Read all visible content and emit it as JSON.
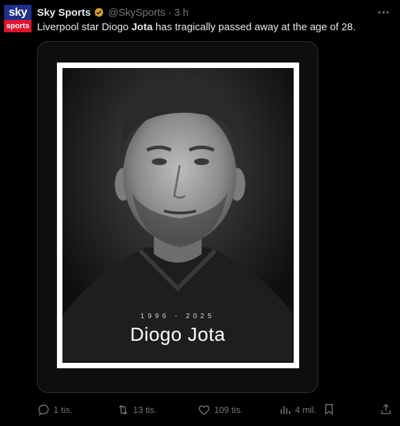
{
  "author": {
    "name": "Sky Sports",
    "handle": "@SkySports",
    "separator": "·",
    "time": "3 h",
    "avatar_top": "sky",
    "avatar_bottom": "sports",
    "verified_color": "#d4a12a"
  },
  "tweet": {
    "text_before": "Liverpool star Diogo ",
    "text_bold": "Jota",
    "text_after": " has tragically passed away at the age of 28."
  },
  "media": {
    "years": "1996 - 2025",
    "name": "Diogo Jota"
  },
  "actions": {
    "reply": "1 tis.",
    "retweet": "13 tis.",
    "like": "109 tis.",
    "views": "4 mil."
  },
  "icons": [
    "more-icon",
    "reply-icon",
    "retweet-icon",
    "like-icon",
    "views-icon",
    "bookmark-icon",
    "share-icon",
    "verified-badge-icon"
  ]
}
